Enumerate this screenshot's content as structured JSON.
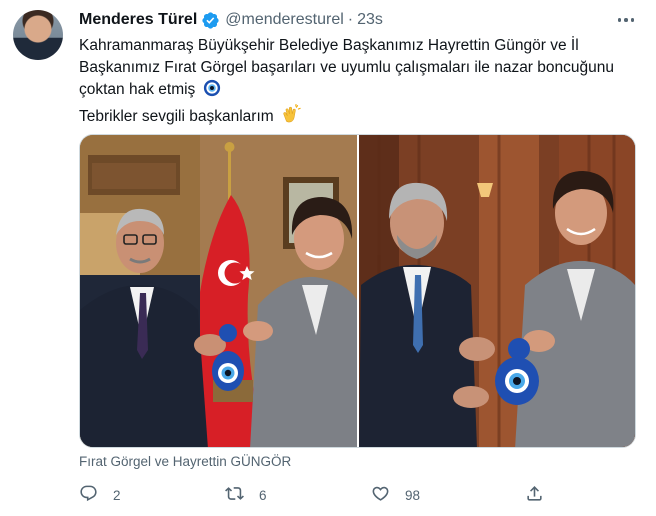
{
  "author": {
    "display_name": "Menderes Türel",
    "handle": "@menderesturel",
    "separator": "·",
    "time": "23s",
    "verified_icon": "verified-badge-icon"
  },
  "tweet": {
    "lines": [
      "Kahramanmaraş Büyükşehir Belediye Başkanımız Hayrettin Güngör ve İl",
      "Başkanımız Fırat Görgel başarıları ve uyumlu çalışmaları ile nazar boncuğunu",
      "çoktan hak etmiş",
      "Tebrikler sevgili başkanlarım"
    ],
    "emojis": [
      "nazar-amulet-icon",
      "clapping-hands-icon"
    ]
  },
  "media": {
    "photos": [
      "photo-left",
      "photo-right"
    ],
    "caption": "Fırat Görgel ve Hayrettin GÜNGÖR"
  },
  "actions": {
    "reply_count": "2",
    "retweet_count": "6",
    "like_count": "98"
  },
  "colors": {
    "text": "#0f1419",
    "secondary": "#536471",
    "verified": "#1d9bf0",
    "border": "#cfd9de"
  }
}
